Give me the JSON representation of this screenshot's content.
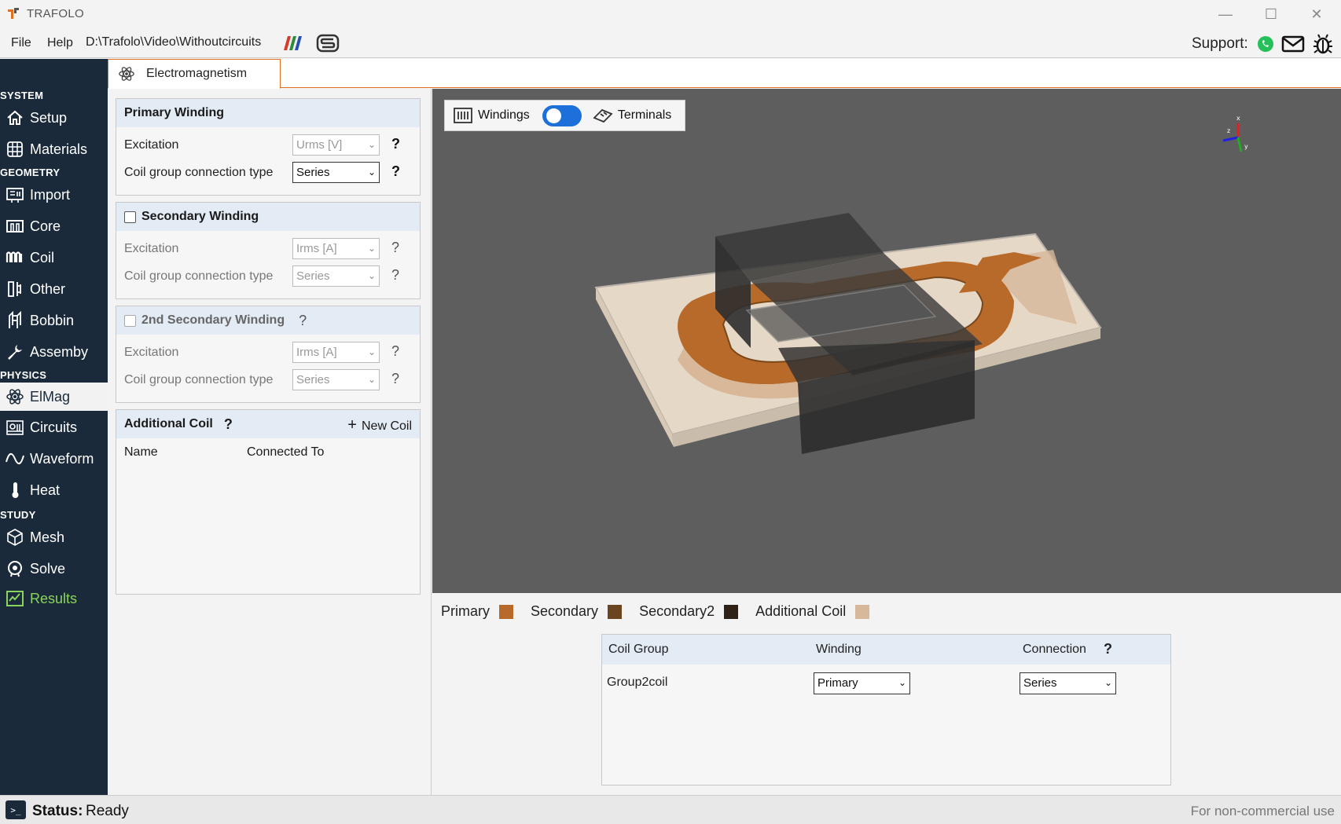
{
  "app": {
    "title": "TRAFOLO"
  },
  "menu": {
    "file": "File",
    "help": "Help",
    "path": "D:\\Trafolo\\Video\\Withoutcircuits"
  },
  "support": {
    "label": "Support:"
  },
  "sidebar": {
    "sections": {
      "system": "SYSTEM",
      "geometry": "GEOMETRY",
      "physics": "PHYSICS",
      "study": "STUDY"
    },
    "items": {
      "setup": "Setup",
      "materials": "Materials",
      "import": "Import",
      "core": "Core",
      "coil": "Coil",
      "other": "Other",
      "bobbin": "Bobbin",
      "assembly": "Assemby",
      "elmag": "ElMag",
      "circuits": "Circuits",
      "waveform": "Waveform",
      "heat": "Heat",
      "mesh": "Mesh",
      "solve": "Solve",
      "results": "Results"
    },
    "active_item": "ElMag"
  },
  "tab": {
    "label": "Electromagnetism"
  },
  "primary": {
    "title": "Primary Winding",
    "excitation_label": "Excitation",
    "excitation_value": "Urms [V]",
    "connection_label": "Coil group connection type",
    "connection_value": "Series"
  },
  "secondary": {
    "title": "Secondary Winding",
    "checked": false,
    "excitation_label": "Excitation",
    "excitation_value": "Irms [A]",
    "connection_label": "Coil group connection type",
    "connection_value": "Series"
  },
  "secondary2": {
    "title": "2nd Secondary Winding",
    "checked": false,
    "excitation_label": "Excitation",
    "excitation_value": "Irms [A]",
    "connection_label": "Coil group connection type",
    "connection_value": "Series"
  },
  "additional": {
    "title": "Additional Coil",
    "new_label": "New Coil",
    "col_name": "Name",
    "col_connected": "Connected To"
  },
  "help_mark": "?",
  "viewer": {
    "windings_label": "Windings",
    "terminals_label": "Terminals",
    "toggle_on": true
  },
  "legend": [
    {
      "label": "Primary",
      "color": "#b86a2a"
    },
    {
      "label": "Secondary",
      "color": "#6b4420"
    },
    {
      "label": "Secondary2",
      "color": "#2e2218"
    },
    {
      "label": "Additional Coil",
      "color": "#d7b89a"
    }
  ],
  "coil_table": {
    "col_group": "Coil Group",
    "col_winding": "Winding",
    "col_connection": "Connection",
    "rows": [
      {
        "group": "Group2coil",
        "winding": "Primary",
        "connection": "Series"
      }
    ]
  },
  "status": {
    "label": "Status:",
    "value": "Ready",
    "note": "For non-commercial use"
  },
  "colors": {
    "sidebar_bg": "#1a2a3a",
    "accent": "#e07020",
    "results": "#8bd35f",
    "toggle": "#1d6fd9"
  }
}
